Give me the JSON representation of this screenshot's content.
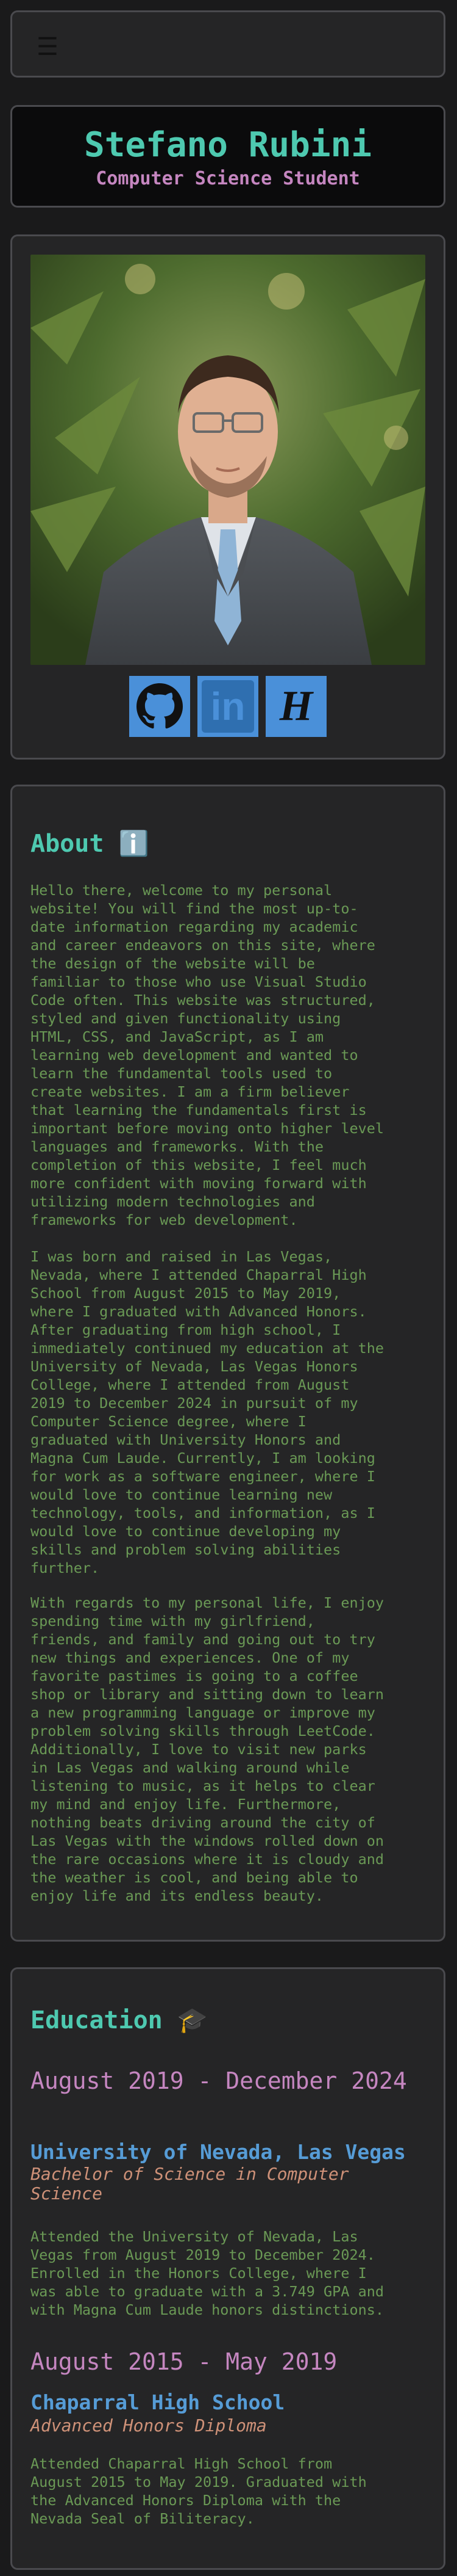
{
  "nav": {
    "menu_icon": "hamburger-icon",
    "menu_glyph": "☰"
  },
  "header": {
    "name": "Stefano Rubini",
    "subtitle": "Computer Science Student"
  },
  "social": [
    {
      "icon": "github-icon"
    },
    {
      "icon": "linkedin-icon",
      "glyph": "in"
    },
    {
      "icon": "handshake-icon",
      "glyph": "H"
    }
  ],
  "about": {
    "title": "About ℹ️",
    "paragraphs": [
      "Hello there, welcome to my personal\nwebsite! You will find the most up-to-\ndate information regarding my academic\nand career endeavors on this site, where\nthe design of the website will be\nfamiliar to those who use Visual Studio\nCode often. This website was structured,\nstyled and given functionality using\nHTML, CSS, and JavaScript, as I am\nlearning web development and wanted to\nlearn the fundamental tools used to\ncreate websites. I am a firm believer\nthat learning the fundamentals first is\nimportant before moving onto higher level\nlanguages and frameworks. With the\ncompletion of this website, I feel much\nmore confident with moving forward with\nutilizing modern technologies and\nframeworks for web development.",
      "I was born and raised in Las Vegas,\nNevada, where I attended Chaparral High\nSchool from August 2015 to May 2019,\nwhere I graduated with Advanced Honors.\nAfter graduating from high school, I\nimmediately continued my education at the\nUniversity of Nevada, Las Vegas Honors\nCollege, where I attended from August\n2019 to December 2024 in pursuit of my\nComputer Science degree, where I\ngraduated with University Honors and\nMagna Cum Laude. Currently, I am looking\nfor work as a software engineer, where I\nwould love to continue learning new\ntechnology, tools, and information, as I\nwould love to continue developing my\nskills and problem solving abilities\nfurther.",
      "With regards to my personal life, I enjoy\nspending time with my girlfriend,\nfriends, and family and going out to try\nnew things and experiences. One of my\nfavorite pastimes is going to a coffee\nshop or library and sitting down to learn\na new programming language or improve my\nproblem solving skills through LeetCode.\nAdditionally, I love to visit new parks\nin Las Vegas and walking around while\nlistening to music, as it helps to clear\nmy mind and enjoy life. Furthermore,\nnothing beats driving around the city of\nLas Vegas with the windows rolled down on\nthe rare occasions where it is cloudy and\nthe weather is cool, and being able to\nenjoy life and its endless beauty."
    ]
  },
  "education": {
    "title": "Education 🎓",
    "entries": [
      {
        "date": "August 2019 - December 2024",
        "school": "University of Nevada, Las Vegas",
        "degree": "Bachelor of Science in Computer Science",
        "description": "Attended the University of Nevada, Las\nVegas from August 2019 to December 2024.\nEnrolled in the Honors College, where I\nwas able to graduate with a 3.749 GPA and\nwith Magna Cum Laude honors distinctions."
      },
      {
        "date": "August 2015 - May 2019",
        "school": "Chaparral High School",
        "degree": "Advanced Honors Diploma",
        "description": "Attended Chaparral High School from\nAugust 2015 to May 2019. Graduated with\nthe Advanced Honors Diploma with the\nNevada Seal of Biliteracy."
      }
    ]
  },
  "colors": {
    "background": "#1a1a1b",
    "card": "#252526",
    "teal": "#4ec9b0",
    "purple": "#c586c0",
    "blue": "#569cd6",
    "orange": "#ce9178",
    "green": "#6a9955",
    "social_blue": "#4a90d9"
  }
}
